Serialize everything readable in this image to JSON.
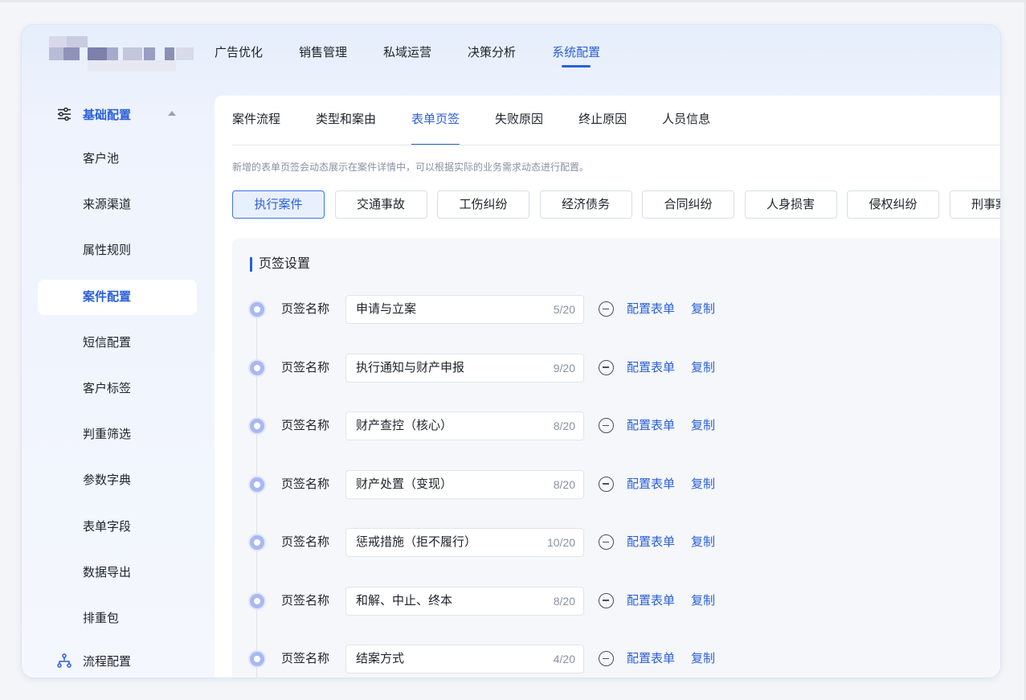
{
  "topnav": {
    "items": [
      {
        "label": "广告优化"
      },
      {
        "label": "销售管理"
      },
      {
        "label": "私域运营"
      },
      {
        "label": "决策分析"
      },
      {
        "label": "系统配置",
        "active": true
      }
    ]
  },
  "sidebar": {
    "group1": {
      "label": "基础配置",
      "icon": "sliders-icon",
      "expanded": true
    },
    "items": [
      {
        "label": "客户池"
      },
      {
        "label": "来源渠道"
      },
      {
        "label": "属性规则"
      },
      {
        "label": "案件配置",
        "active": true
      },
      {
        "label": "短信配置"
      },
      {
        "label": "客户标签"
      },
      {
        "label": "判重筛选"
      },
      {
        "label": "参数字典"
      },
      {
        "label": "表单字段"
      },
      {
        "label": "数据导出"
      },
      {
        "label": "排重包"
      }
    ],
    "group2": {
      "label": "流程配置",
      "icon": "flow-icon"
    }
  },
  "subtabs": [
    {
      "label": "案件流程"
    },
    {
      "label": "类型和案由"
    },
    {
      "label": "表单页签",
      "active": true
    },
    {
      "label": "失败原因"
    },
    {
      "label": "终止原因"
    },
    {
      "label": "人员信息"
    }
  ],
  "hint": "新增的表单页签会动态展示在案件详情中，可以根据实际的业务需求动态进行配置。",
  "case_types": [
    {
      "label": "执行案件",
      "active": true
    },
    {
      "label": "交通事故"
    },
    {
      "label": "工伤纠纷"
    },
    {
      "label": "经济债务"
    },
    {
      "label": "合同纠纷"
    },
    {
      "label": "人身损害"
    },
    {
      "label": "侵权纠纷"
    },
    {
      "label": "刑事案件"
    }
  ],
  "panel": {
    "title": "页签设置",
    "row_label": "页签名称",
    "config_label": "配置表单",
    "copy_label": "复制",
    "rows": [
      {
        "value": "申请与立案",
        "count": "5/20"
      },
      {
        "value": "执行通知与财产申报",
        "count": "9/20"
      },
      {
        "value": "财产查控（核心）",
        "count": "8/20"
      },
      {
        "value": "财产处置（变现）",
        "count": "8/20"
      },
      {
        "value": "惩戒措施（拒不履行）",
        "count": "10/20"
      },
      {
        "value": "和解、中止、终本",
        "count": "8/20"
      },
      {
        "value": "结案方式",
        "count": "4/20"
      }
    ]
  },
  "colors": {
    "accent": "#2a5fd9",
    "active_bg": "#e8effd"
  }
}
